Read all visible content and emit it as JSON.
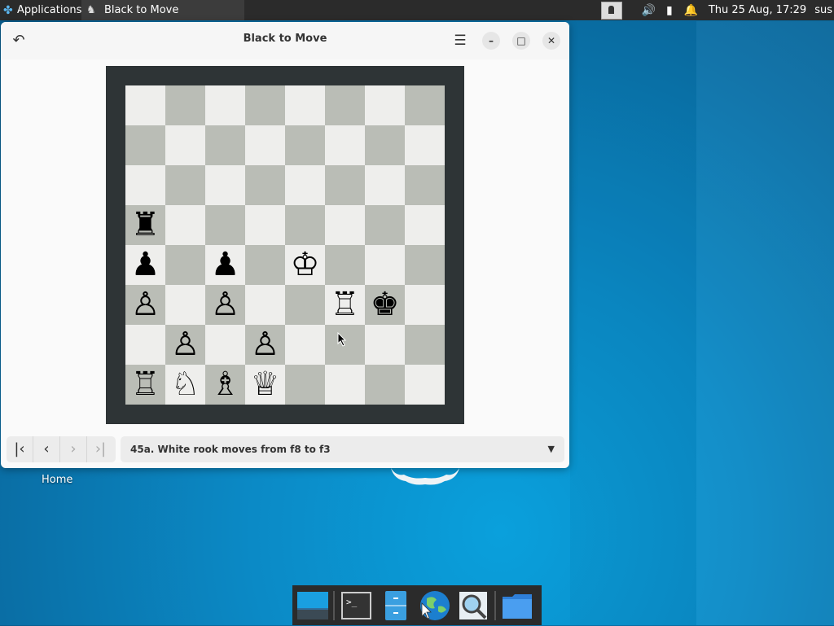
{
  "top_panel": {
    "apps_label": "Applications",
    "task_title": "Black to Move",
    "clock": "Thu 25 Aug, 17:29",
    "user": "sus"
  },
  "window": {
    "title": "Black to Move",
    "board": {
      "light_color": "#eeeeec",
      "dark_color": "#babdb6",
      "frame_color": "#2e3436",
      "ranks": [
        [
          "",
          "",
          "",
          "",
          "",
          "",
          "",
          ""
        ],
        [
          "",
          "",
          "",
          "",
          "",
          "",
          "",
          ""
        ],
        [
          "",
          "",
          "",
          "",
          "",
          "",
          "",
          ""
        ],
        [
          "♜",
          "",
          "",
          "",
          "",
          "",
          "",
          ""
        ],
        [
          "♟",
          "",
          "♟",
          "",
          "♔",
          "",
          "",
          ""
        ],
        [
          "♙",
          "",
          "♙",
          "",
          "",
          "♖",
          "♚",
          ""
        ],
        [
          "",
          "♙",
          "",
          "♙",
          "",
          "",
          "",
          ""
        ],
        [
          "♖",
          "♘",
          "♗",
          "♕",
          "",
          "",
          "",
          ""
        ]
      ]
    },
    "navigation": {
      "first": "⏮",
      "prev": "‹",
      "next": "›",
      "last": "⏭"
    },
    "move_selector": {
      "current": "45a. White rook moves from f8 to f3"
    }
  },
  "desktop": {
    "home_label": "Home"
  }
}
